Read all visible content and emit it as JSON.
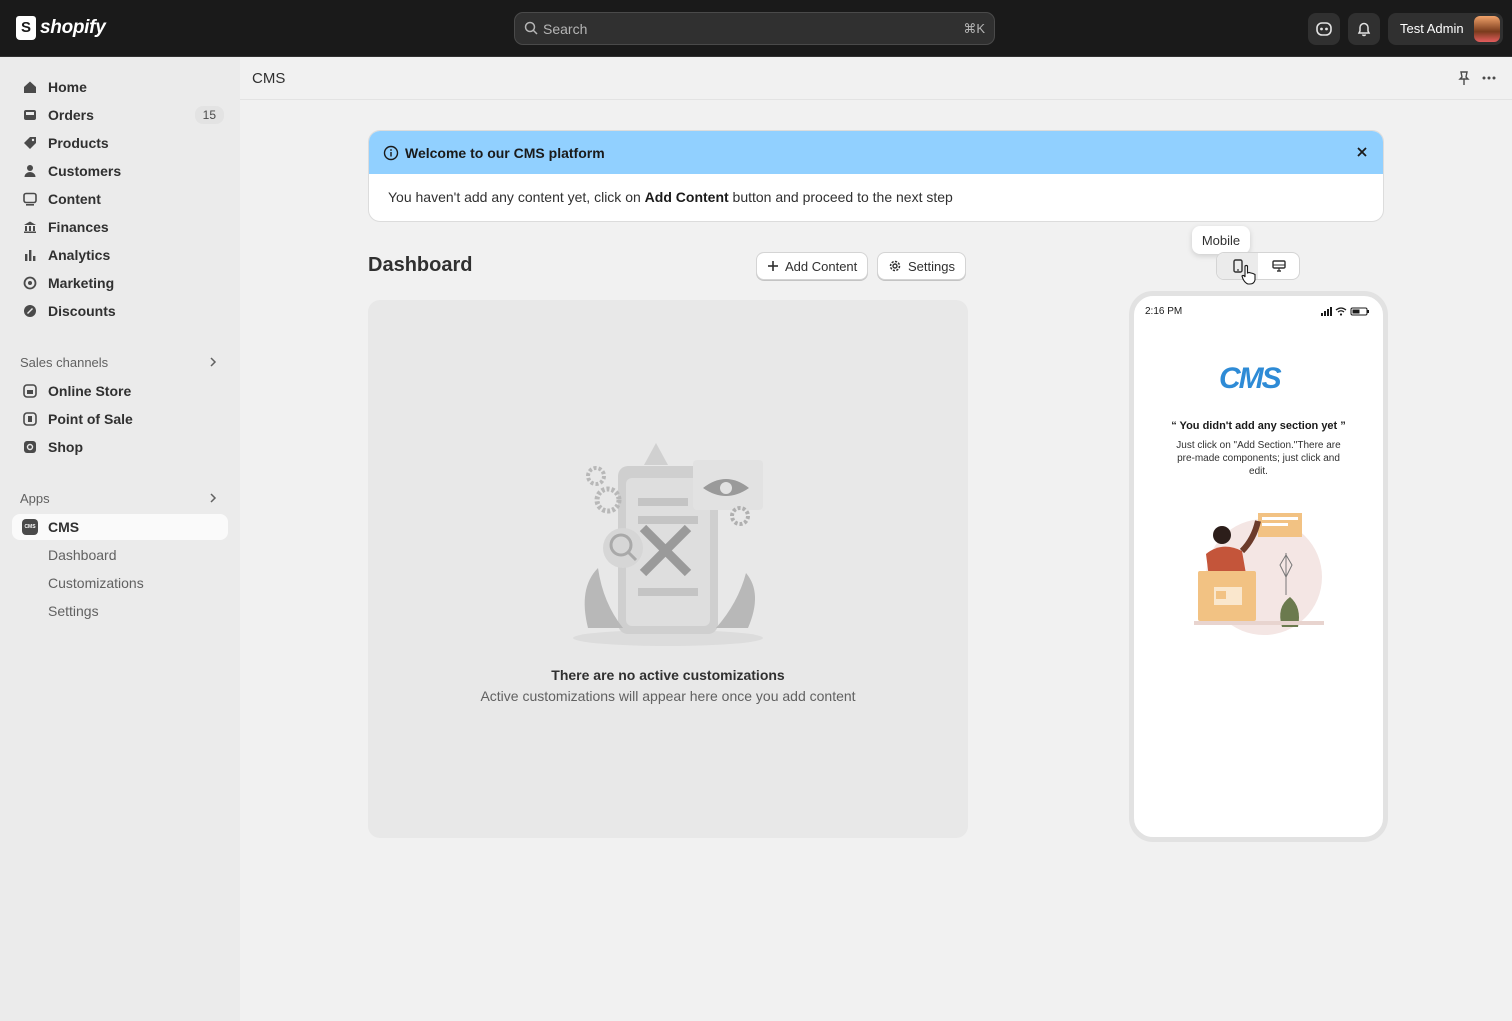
{
  "topbar": {
    "brand": "shopify",
    "search_placeholder": "Search",
    "search_shortcut": "⌘K",
    "user_name": "Test Admin"
  },
  "sidebar": {
    "items": [
      {
        "label": "Home",
        "icon": "home-icon"
      },
      {
        "label": "Orders",
        "icon": "inbox-icon",
        "badge": "15"
      },
      {
        "label": "Products",
        "icon": "tag-icon"
      },
      {
        "label": "Customers",
        "icon": "person-icon"
      },
      {
        "label": "Content",
        "icon": "image-icon"
      },
      {
        "label": "Finances",
        "icon": "bank-icon"
      },
      {
        "label": "Analytics",
        "icon": "bar-chart-icon"
      },
      {
        "label": "Marketing",
        "icon": "target-icon"
      },
      {
        "label": "Discounts",
        "icon": "discount-icon"
      }
    ],
    "sales_channels_label": "Sales channels",
    "sales_channels": [
      {
        "label": "Online Store",
        "icon": "store-icon"
      },
      {
        "label": "Point of Sale",
        "icon": "pos-icon"
      },
      {
        "label": "Shop",
        "icon": "shop-icon"
      }
    ],
    "apps_label": "Apps",
    "app": {
      "label": "CMS",
      "icon_text": "CMS"
    },
    "app_subitems": [
      "Dashboard",
      "Customizations",
      "Settings"
    ]
  },
  "page": {
    "title": "CMS"
  },
  "banner": {
    "title": "Welcome to our CMS platform",
    "text_before": "You haven't add any content  yet, click on ",
    "text_bold": "Add Content",
    "text_after": " button and proceed to the next step"
  },
  "dashboard": {
    "title": "Dashboard",
    "add_content_label": "Add Content",
    "settings_label": "Settings",
    "empty_title": "There are no active customizations",
    "empty_subtitle": "Active customizations will appear here once you add content"
  },
  "preview": {
    "tooltip": "Mobile",
    "phone_time": "2:16 PM",
    "logo_text": "CMS",
    "empty_title": "“ You didn't add any section yet ”",
    "empty_body": "Just click on \"Add Section.\"There are pre-made components; just click and edit."
  },
  "colors": {
    "topbar_bg": "#1a1a1a",
    "banner_header": "#91d0ff",
    "cms_logo": "#2e8bd6"
  }
}
